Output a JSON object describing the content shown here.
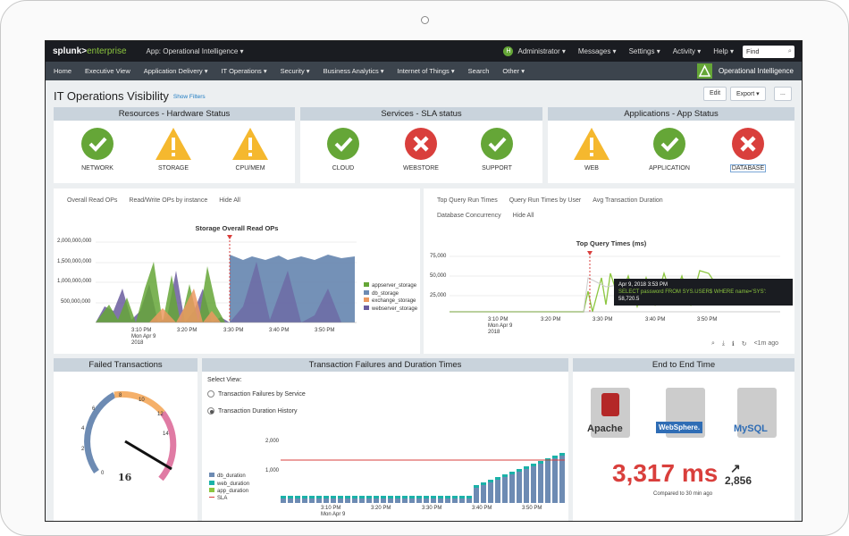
{
  "topbar": {
    "logo_a": "splunk>",
    "logo_b": "enterprise",
    "app": "App: Operational Intelligence ▾",
    "avatar": "H",
    "admin": "Administrator ▾",
    "messages": "Messages ▾",
    "settings": "Settings ▾",
    "activity": "Activity ▾",
    "help": "Help ▾",
    "find": "Find"
  },
  "nav": {
    "items": [
      "Home",
      "Executive View",
      "Application Delivery ▾",
      "IT Operations ▾",
      "Security ▾",
      "Business Analytics ▾",
      "Internet of Things ▾",
      "Search",
      "Other ▾"
    ],
    "app_name": "Operational Intelligence"
  },
  "page": {
    "title": "IT Operations Visibility",
    "show_filters": "Show Filters",
    "edit": "Edit",
    "export": "Export ▾",
    "more": "..."
  },
  "sections": {
    "hardware": "Resources - Hardware Status",
    "sla": "Services - SLA status",
    "apps": "Applications - App Status",
    "failed": "Failed Transactions",
    "tfd": "Transaction Failures and Duration Times",
    "e2e": "End to End Time"
  },
  "status": {
    "network": "NETWORK",
    "storage": "STORAGE",
    "cpu": "CPU/MEM",
    "cloud": "CLOUD",
    "webstore": "WEBSTORE",
    "support": "SUPPORT",
    "web": "WEB",
    "application": "APPLICATION",
    "database": "DATABASE"
  },
  "colors": {
    "ok": "#65a637",
    "warn": "#f5b82e",
    "err": "#d93f3c"
  },
  "storage_chart": {
    "tabs": [
      "Overall Read OPs",
      "Read/Write OPs by instance",
      "Hide All"
    ],
    "title": "Storage Overall Read OPs",
    "yticks": [
      "2,000,000,000",
      "1,500,000,000",
      "1,000,000,000",
      "500,000,000"
    ],
    "xticks": [
      "3:10 PM",
      "3:20 PM",
      "3:30 PM",
      "3:40 PM",
      "3:50 PM"
    ],
    "xdate": [
      "Mon Apr 9",
      "2018"
    ],
    "legend": [
      "appserver_storage",
      "db_storage",
      "exchange_storage",
      "webserver_storage"
    ]
  },
  "query_chart": {
    "tabs": [
      "Top Query Run Times",
      "Query Run Times by User",
      "Avg Transaction Duration"
    ],
    "tabs2": [
      "Database Concurrency",
      "Hide All"
    ],
    "title": "Top Query Times (ms)",
    "yticks": [
      "75,000",
      "50,000",
      "25,000"
    ],
    "xticks": [
      "3:10 PM",
      "3:20 PM",
      "3:30 PM",
      "3:40 PM",
      "3:50 PM"
    ],
    "xdate": [
      "Mon Apr 9",
      "2018"
    ],
    "tip_date": "Apr 9, 2018 3:53 PM",
    "tip_query": "SELECT password FROM SYS.USER$ WHERE name='SYS':",
    "tip_val": "58,720.5",
    "ago": "<1m ago"
  },
  "gauge": {
    "ticks": [
      "0",
      "2",
      "4",
      "6",
      "8",
      "10",
      "12",
      "14"
    ],
    "value": "16"
  },
  "tfd": {
    "select_label": "Select View:",
    "opt1": "Transaction Failures by Service",
    "opt2": "Transaction Duration History",
    "yticks": [
      "2,000",
      "1,000"
    ],
    "xticks": [
      "3:10 PM",
      "3:20 PM",
      "3:30 PM",
      "3:40 PM",
      "3:50 PM"
    ],
    "xdate": [
      "Mon Apr 9"
    ],
    "legend": [
      "db_duration",
      "web_duration",
      "app_duration",
      "SLA"
    ]
  },
  "e2e": {
    "apache": "Apache",
    "websphere": "WebSphere.",
    "mysql": "MySQL",
    "ms": "3,317 ms",
    "delta": "2,856",
    "compared": "Compared to 30 min ago"
  }
}
